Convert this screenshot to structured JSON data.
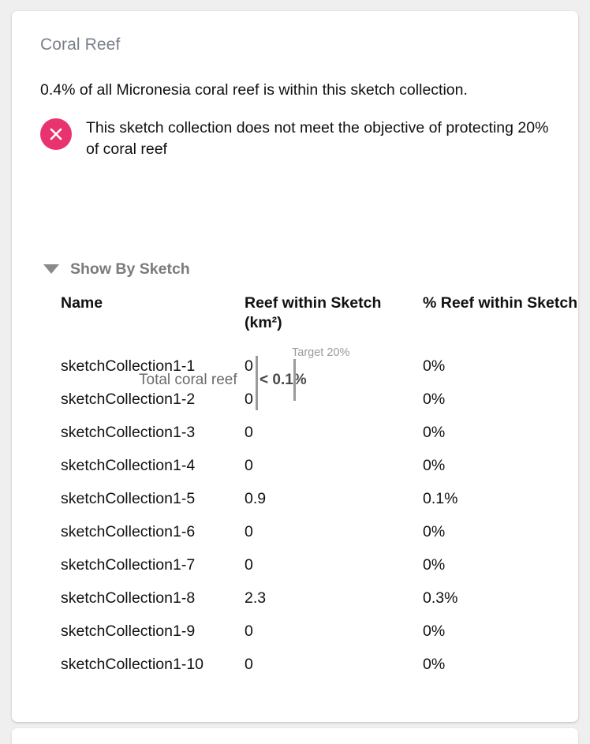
{
  "card": {
    "title": "Coral Reef",
    "summary": "0.4% of all Micronesia coral reef is within this sketch collection.",
    "objective": {
      "icon": "x-circle-icon",
      "icon_color": "#e8336e",
      "message": "This sketch collection does not meet the objective of protecting 20% of coral reef"
    }
  },
  "chart_data": {
    "type": "bar",
    "orientation": "horizontal",
    "title": "",
    "categories": [
      "Total coral reef"
    ],
    "values": [
      0.1
    ],
    "value_labels": [
      "< 0.1%"
    ],
    "target": 20,
    "target_label": "Target 20%",
    "xlabel": "",
    "ylabel": "",
    "xlim": [
      0,
      100
    ],
    "grid": false,
    "legend": "none",
    "axis_color": "#9a9a9a",
    "label_color": "#6b6b6b",
    "value_color": "#4a4a4a"
  },
  "collapse": {
    "caret": "caret-down-icon",
    "label": "Show By Sketch",
    "expanded": true
  },
  "table": {
    "columns": [
      "Name",
      "Reef within Sketch (km²)",
      "% Reef within Sketch"
    ],
    "rows": [
      {
        "name": "sketchCollection1-1",
        "area": "0",
        "pct": "0%"
      },
      {
        "name": "sketchCollection1-2",
        "area": "0",
        "pct": "0%"
      },
      {
        "name": "sketchCollection1-3",
        "area": "0",
        "pct": "0%"
      },
      {
        "name": "sketchCollection1-4",
        "area": "0",
        "pct": "0%"
      },
      {
        "name": "sketchCollection1-5",
        "area": "0.9",
        "pct": "0.1%"
      },
      {
        "name": "sketchCollection1-6",
        "area": "0",
        "pct": "0%"
      },
      {
        "name": "sketchCollection1-7",
        "area": "0",
        "pct": "0%"
      },
      {
        "name": "sketchCollection1-8",
        "area": "2.3",
        "pct": "0.3%"
      },
      {
        "name": "sketchCollection1-9",
        "area": "0",
        "pct": "0%"
      },
      {
        "name": "sketchCollection1-10",
        "area": "0",
        "pct": "0%"
      }
    ]
  }
}
